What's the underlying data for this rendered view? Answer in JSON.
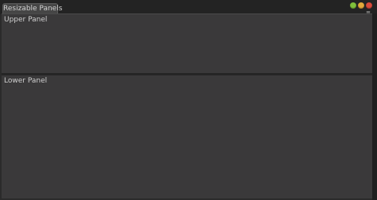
{
  "window": {
    "tab_title": "Resizable Panels"
  },
  "panels": {
    "upper": {
      "label": "Upper Panel"
    },
    "lower": {
      "label": "Lower Panel"
    }
  },
  "icons": {
    "minimize": "green-circle-icon",
    "maximize": "orange-circle-icon",
    "close": "red-circle-icon",
    "menu": "window-menu-icon"
  },
  "colors": {
    "background": "#2b2b2b",
    "panel": "#3a393a",
    "tab": "#464646",
    "text": "#cfcfcf"
  }
}
